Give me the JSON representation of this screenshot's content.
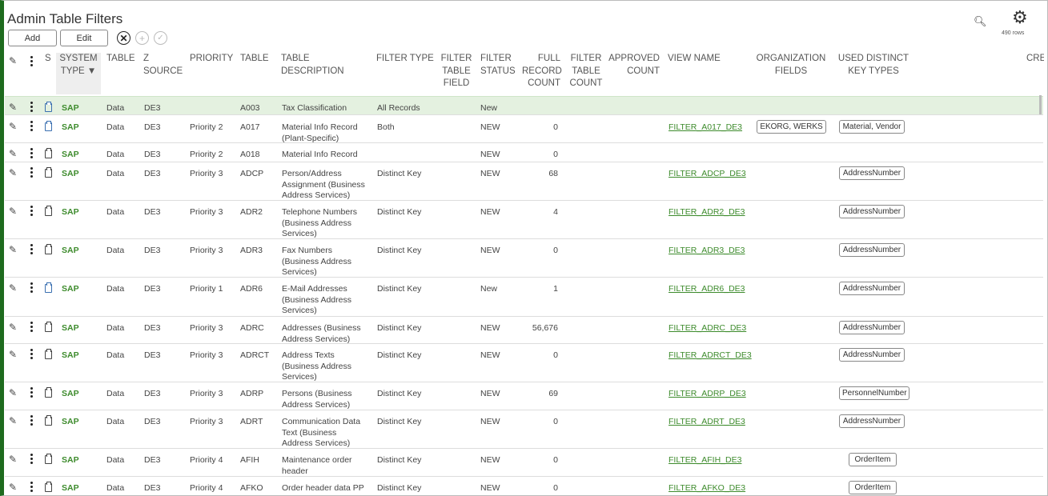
{
  "page": {
    "title": "Admin Table Filters",
    "add_label": "Add",
    "edit_label": "Edit",
    "row_count": "490 rows"
  },
  "columns": {
    "s": "S",
    "system_type": "SYSTEM TYPE ▼",
    "table": "TABLE",
    "z_source": "Z SOURCE",
    "priority": "PRIORITY",
    "table_name": "TABLE",
    "table_description": "TABLE DESCRIPTION",
    "filter_type": "FILTER TYPE",
    "filter_table_field": "FILTER TABLE FIELD",
    "filter_status": "FILTER STATUS",
    "full_record_count": "FULL RECORD COUNT",
    "filter_table_count": "FILTER TABLE COUNT",
    "approved_count": "APPROVED COUNT",
    "view_name": "VIEW NAME",
    "organization_fields": "ORGANIZATION FIELDS",
    "used_distinct_key_types": "USED DISTINCT KEY TYPES",
    "cre": "CRE"
  },
  "rows": [
    {
      "sys": "SAP",
      "table": "Data",
      "src": "DE3",
      "priority": "",
      "name": "A003",
      "desc": "Tax Classification",
      "ftype": "All Records",
      "status": "New",
      "count": "",
      "view": "",
      "org": "",
      "key": "",
      "selected": true,
      "doc_blue": true
    },
    {
      "sys": "SAP",
      "table": "Data",
      "src": "DE3",
      "priority": "Priority 2",
      "name": "A017",
      "desc": "Material Info Record (Plant-Specific)",
      "ftype": "Both",
      "status": "NEW",
      "count": "0",
      "view": "FILTER_A017_DE3",
      "org": "EKORG, WERKS",
      "key": "Material, Vendor",
      "doc_blue": true
    },
    {
      "sys": "SAP",
      "table": "Data",
      "src": "DE3",
      "priority": "Priority 2",
      "name": "A018",
      "desc": "Material Info Record",
      "ftype": "",
      "status": "NEW",
      "count": "0",
      "view": "",
      "org": "",
      "key": ""
    },
    {
      "sys": "SAP",
      "table": "Data",
      "src": "DE3",
      "priority": "Priority 3",
      "name": "ADCP",
      "desc": "Person/Address Assignment (Business Address Services)",
      "ftype": "Distinct Key",
      "status": "NEW",
      "count": "68",
      "view": "FILTER_ADCP_DE3",
      "org": "",
      "key": "AddressNumber"
    },
    {
      "sys": "SAP",
      "table": "Data",
      "src": "DE3",
      "priority": "Priority 3",
      "name": "ADR2",
      "desc": "Telephone Numbers (Business Address Services)",
      "ftype": "Distinct Key",
      "status": "NEW",
      "count": "4",
      "view": "FILTER_ADR2_DE3",
      "org": "",
      "key": "AddressNumber"
    },
    {
      "sys": "SAP",
      "table": "Data",
      "src": "DE3",
      "priority": "Priority 3",
      "name": "ADR3",
      "desc": "Fax Numbers (Business Address Services)",
      "ftype": "Distinct Key",
      "status": "NEW",
      "count": "0",
      "view": "FILTER_ADR3_DE3",
      "org": "",
      "key": "AddressNumber"
    },
    {
      "sys": "SAP",
      "table": "Data",
      "src": "DE3",
      "priority": "Priority 1",
      "name": "ADR6",
      "desc": "E-Mail Addresses (Business Address Services)",
      "ftype": "Distinct Key",
      "status": "New",
      "count": "1",
      "view": "FILTER_ADR6_DE3",
      "org": "",
      "key": "AddressNumber",
      "doc_blue": true
    },
    {
      "sys": "SAP",
      "table": "Data",
      "src": "DE3",
      "priority": "Priority 3",
      "name": "ADRC",
      "desc": "Addresses (Business Address Services)",
      "ftype": "Distinct Key",
      "status": "NEW",
      "count": "56,676",
      "view": "FILTER_ADRC_DE3",
      "org": "",
      "key": "AddressNumber"
    },
    {
      "sys": "SAP",
      "table": "Data",
      "src": "DE3",
      "priority": "Priority 3",
      "name": "ADRCT",
      "desc": "Address Texts (Business Address Services)",
      "ftype": "Distinct Key",
      "status": "NEW",
      "count": "0",
      "view": "FILTER_ADRCT_DE3",
      "org": "",
      "key": "AddressNumber"
    },
    {
      "sys": "SAP",
      "table": "Data",
      "src": "DE3",
      "priority": "Priority 3",
      "name": "ADRP",
      "desc": "Persons (Business Address Services)",
      "ftype": "Distinct Key",
      "status": "NEW",
      "count": "69",
      "view": "FILTER_ADRP_DE3",
      "org": "",
      "key": "PersonnelNumber"
    },
    {
      "sys": "SAP",
      "table": "Data",
      "src": "DE3",
      "priority": "Priority 3",
      "name": "ADRT",
      "desc": "Communication Data Text (Business Address Services)",
      "ftype": "Distinct Key",
      "status": "NEW",
      "count": "0",
      "view": "FILTER_ADRT_DE3",
      "org": "",
      "key": "AddressNumber"
    },
    {
      "sys": "SAP",
      "table": "Data",
      "src": "DE3",
      "priority": "Priority 4",
      "name": "AFIH",
      "desc": "Maintenance order header",
      "ftype": "Distinct Key",
      "status": "NEW",
      "count": "0",
      "view": "FILTER_AFIH_DE3",
      "org": "",
      "key": "OrderItem"
    },
    {
      "sys": "SAP",
      "table": "Data",
      "src": "DE3",
      "priority": "Priority 4",
      "name": "AFKO",
      "desc": "Order header data PP",
      "ftype": "Distinct Key",
      "status": "NEW",
      "count": "0",
      "view": "FILTER_AFKO_DE3",
      "org": "",
      "key": "OrderItem"
    }
  ]
}
